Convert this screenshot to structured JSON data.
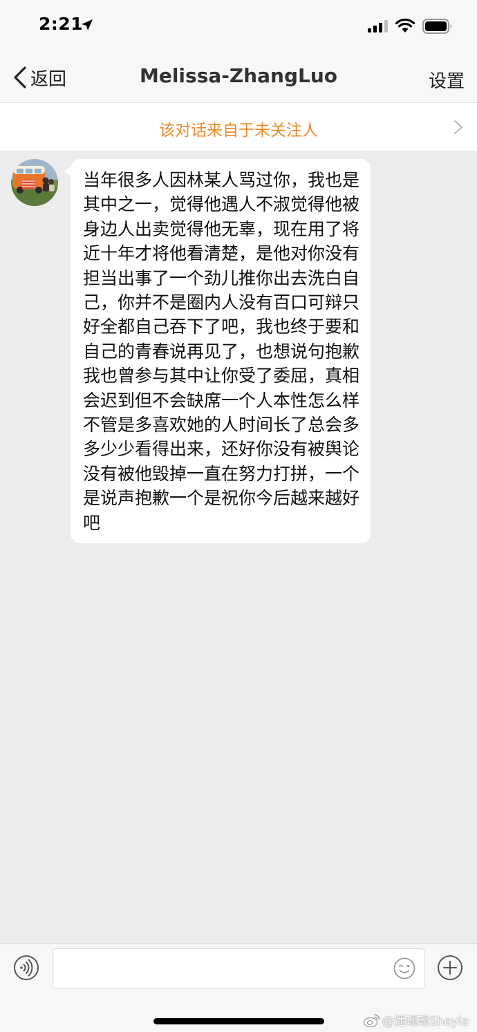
{
  "status_bar": {
    "time": "2:21",
    "icons": [
      "location-arrow-icon",
      "signal-icon",
      "wifi-icon",
      "battery-icon"
    ]
  },
  "nav": {
    "back_label": "返回",
    "title": "Melissa-ZhangLuo",
    "settings_label": "设置",
    "icons": [
      "chevron-left-icon"
    ]
  },
  "notice": {
    "text": "该对话来自于未关注人",
    "icon": "chevron-right-icon"
  },
  "conversation": {
    "messages": [
      {
        "sender": "other",
        "avatar_icon": "avatar",
        "text": "当年很多人因林某人骂过你，我也是其中之一，觉得他遇人不淑觉得他被身边人出卖觉得他无辜，现在用了将近十年才将他看清楚，是他对你没有担当出事了一个劲儿推你出去洗白自己，你并不是圈内人没有百口可辩只好全都自己吞下了吧，我也终于要和自己的青春说再见了，也想说句抱歉我也曾参与其中让你受了委屈，真相会迟到但不会缺席一个人本性怎么样不管是多喜欢她的人时间长了总会多多少少看得出来，还好你没有被舆论没有被他毁掉一直在努力打拼，一个是说声抱歉一个是祝你今后越来越好吧"
      }
    ]
  },
  "input_bar": {
    "placeholder": "",
    "value": "",
    "icons": [
      "voice-icon",
      "emoji-icon",
      "plus-icon"
    ]
  },
  "watermark": {
    "text": "@潘瑶瑶Shayla",
    "icon": "weibo-logo-icon"
  },
  "colors": {
    "background": "#ececec",
    "bar": "#f7f7f7",
    "accent_orange": "#ee8a2a",
    "bubble": "#ffffff"
  }
}
